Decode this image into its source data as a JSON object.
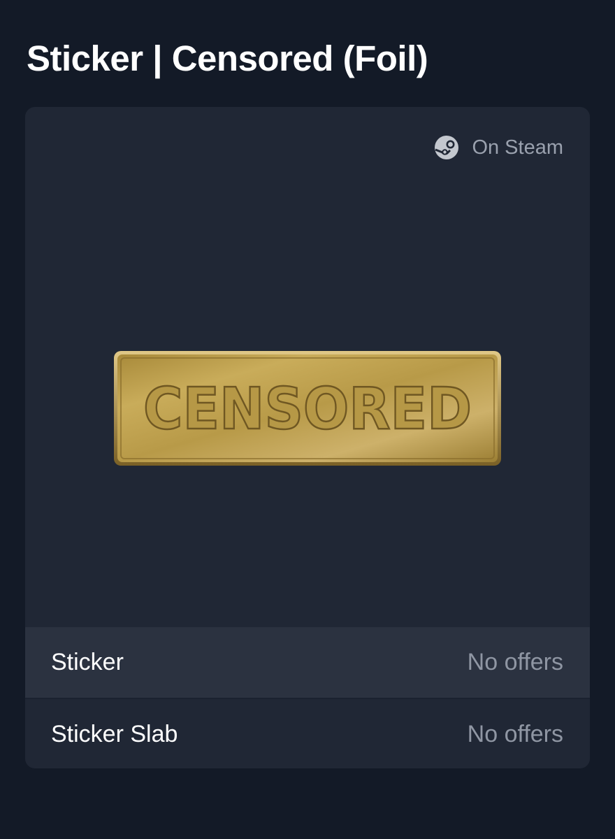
{
  "page": {
    "title": "Sticker | Censored (Foil)"
  },
  "card": {
    "steam_link": {
      "label": "On Steam",
      "icon": "steam-icon"
    },
    "preview": {
      "image_alt": "Sticker | Censored (Foil)",
      "sticker_text": "CENSORED"
    },
    "offers": [
      {
        "label": "Sticker",
        "value": "No offers"
      },
      {
        "label": "Sticker Slab",
        "value": "No offers"
      }
    ]
  },
  "colors": {
    "background": "#131a27",
    "card": "#202735",
    "row_highlight": "#2b3240",
    "muted_text": "#8f96a3",
    "gold": "#c4a24e"
  }
}
